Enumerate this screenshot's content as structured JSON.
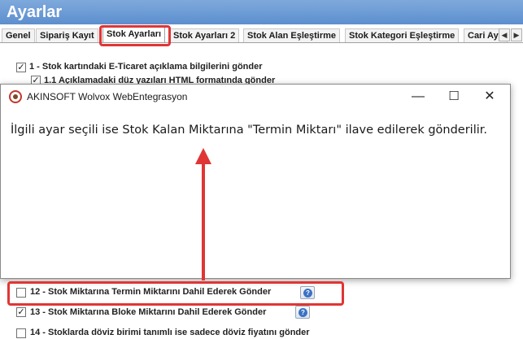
{
  "window": {
    "title": "Ayarlar"
  },
  "tabs": [
    {
      "label": "Genel"
    },
    {
      "label": "Sipariş Kayıt"
    },
    {
      "label": "Stok Ayarları",
      "active": true
    },
    {
      "label": "Stok Ayarları 2"
    },
    {
      "label": "Stok Alan Eşleştirme"
    },
    {
      "label": "Stok Kategori Eşleştirme"
    },
    {
      "label": "Cari Ayar"
    }
  ],
  "tab_scroll": {
    "left_glyph": "◀",
    "right_glyph": "▶"
  },
  "options": [
    {
      "label": "1 - Stok kartındaki E-Ticaret açıklama bilgilerini gönder",
      "checked": true
    },
    {
      "label": "1.1 Açıklamadaki düz yazıları HTML formatında gönder",
      "checked": true
    },
    {
      "label": "12 - Stok Miktarına Termin Miktarını Dahil Ederek Gönder",
      "checked": false
    },
    {
      "label": "13 - Stok Miktarına Bloke Miktarını Dahil Ederek Gönder",
      "checked": true
    },
    {
      "label": "14 - Stoklarda döviz birimi tanımlı ise sadece döviz fiyatını gönder",
      "checked": false
    }
  ],
  "check_glyph": "✓",
  "help_glyph": "?",
  "dialog": {
    "title": "AKINSOFT Wolvox WebEntegrasyon",
    "message": "İlgili ayar seçili ise Stok Kalan Miktarına \"Termin Miktarı\" ilave edilerek gönderilir.",
    "minimize_glyph": "—",
    "maximize_glyph": "☐",
    "close_glyph": "✕"
  },
  "colors": {
    "highlight": "#e03535",
    "titlebar": "#6b9ad4",
    "help_icon": "#3b72c4"
  }
}
